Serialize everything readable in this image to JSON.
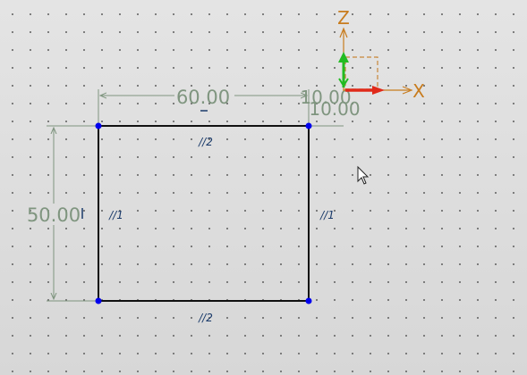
{
  "dimensions": {
    "width": "60.00",
    "height": "50.00",
    "offset_x": "10.00",
    "offset_y": "10.00"
  },
  "constraints": {
    "parallel_top": "//2",
    "parallel_bottom": "//2",
    "parallel_left": "//1",
    "parallel_right": "//1"
  },
  "triad": {
    "x_label": "X",
    "z_label": "Z"
  },
  "colors": {
    "background": "#dfdfdf",
    "grid_dot": "#6a6a6a",
    "sketch_line": "#111111",
    "vertex": "#0000ee",
    "dimension": "#7f957f",
    "axis_x": "#e02a1a",
    "axis_y": "#22bb22",
    "axis_label": "#c87c1e"
  },
  "icons": [
    "mouse-pointer-icon",
    "coordinate-triad-icon"
  ]
}
